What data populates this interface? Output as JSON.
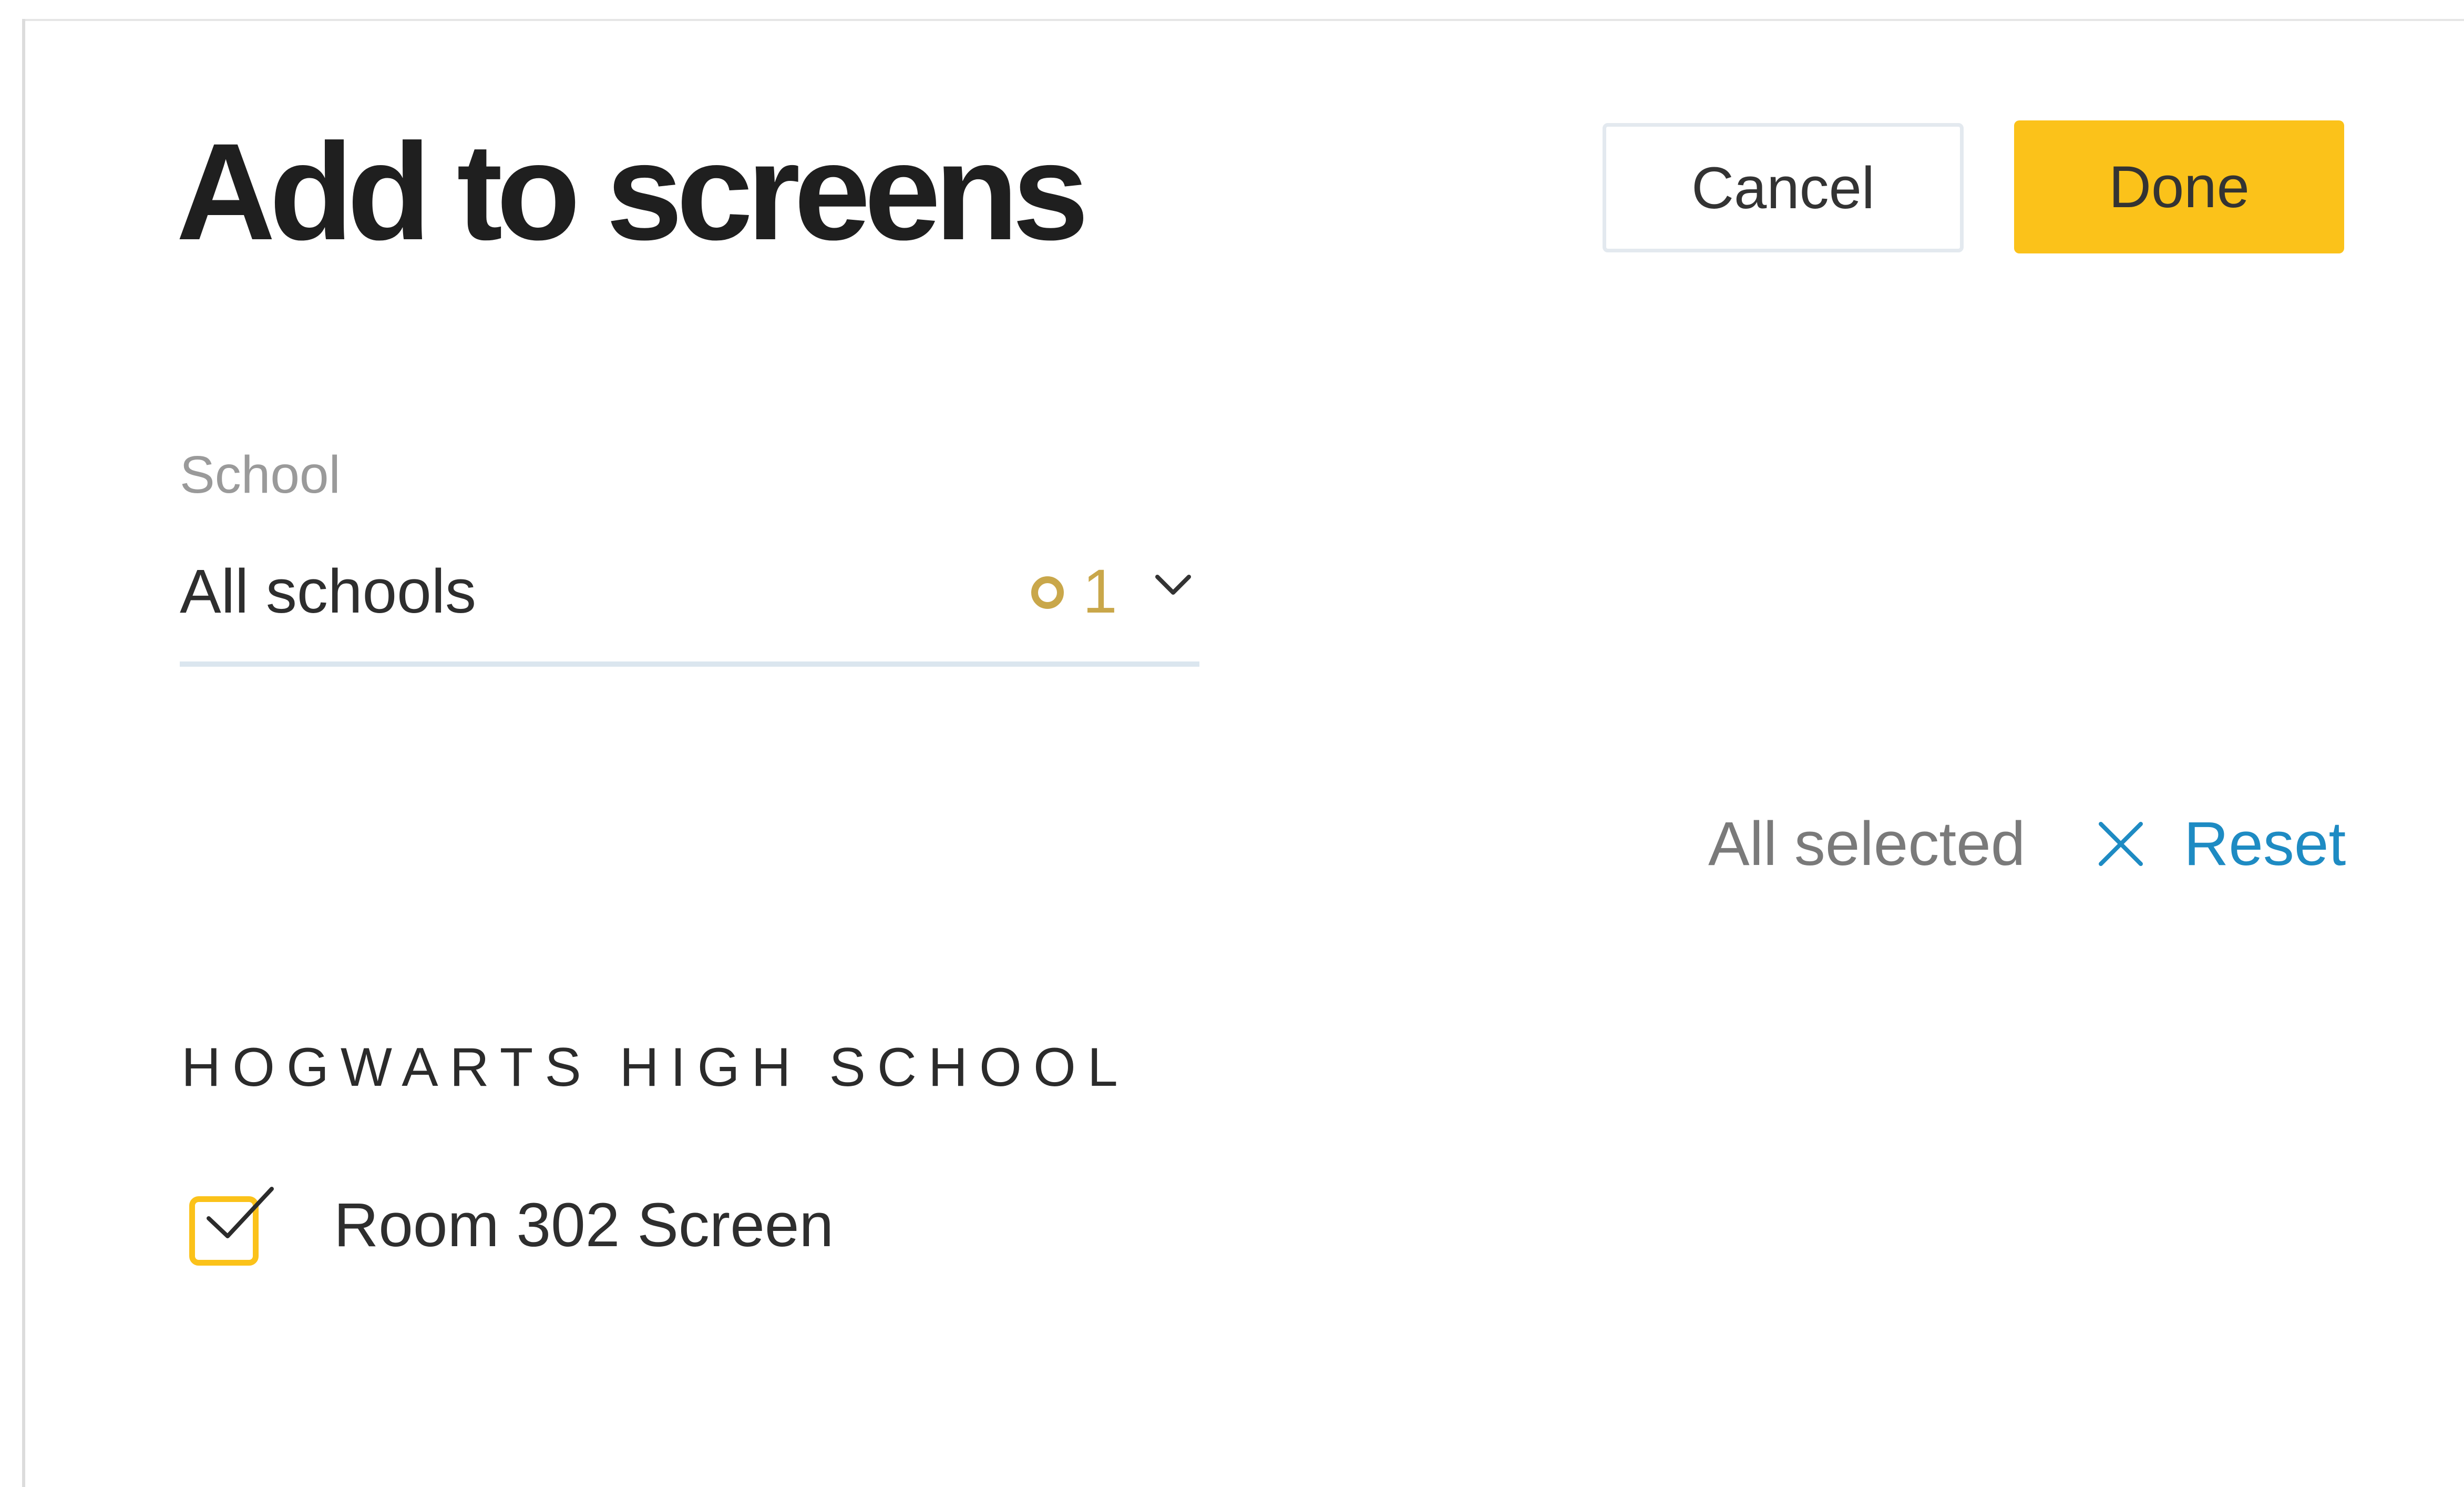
{
  "dialog": {
    "title": "Add to screens",
    "actions": {
      "cancel_label": "Cancel",
      "done_label": "Done"
    }
  },
  "school_filter": {
    "label": "School",
    "value": "All schools",
    "selected_count": "1"
  },
  "selection": {
    "status": "All selected",
    "reset_label": "Reset"
  },
  "groups": [
    {
      "heading": "HOGWARTS HIGH SCHOOL",
      "items": [
        {
          "label": "Room 302 Screen",
          "checked": true
        }
      ]
    }
  ],
  "icons": {
    "chevron": "chevron-down-icon",
    "reset": "close-icon",
    "count": "ring-icon",
    "check": "checkmark-icon"
  },
  "colors": {
    "accent": "#fbc21a",
    "link": "#1e8bc3",
    "count_badge": "#c9a74a",
    "underline": "#dbe6ef"
  }
}
